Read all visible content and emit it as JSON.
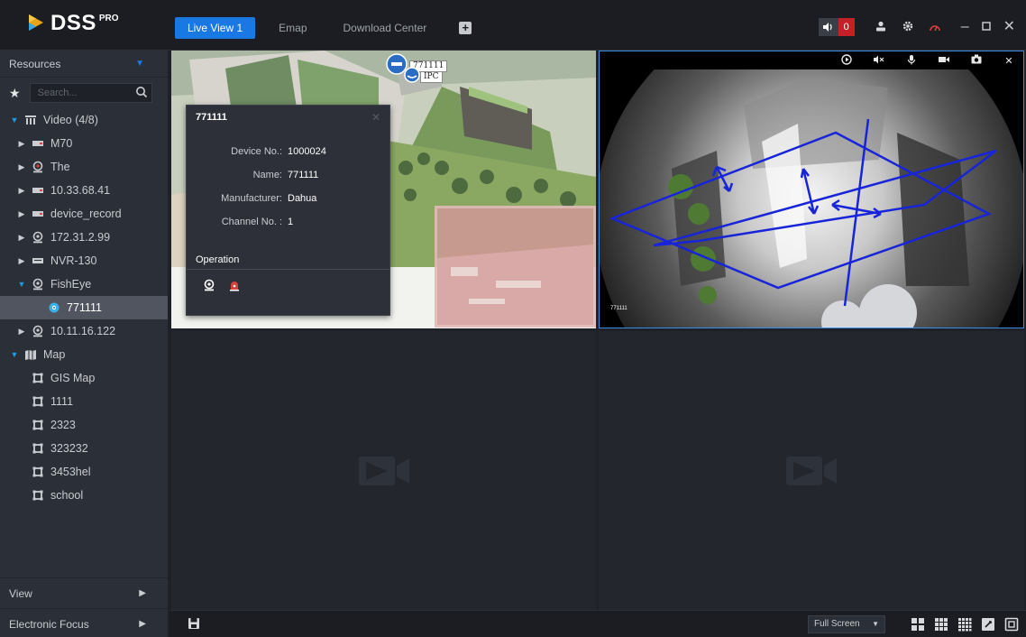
{
  "app": {
    "brand": "DSS",
    "brand_sup": "PRO"
  },
  "tabs": [
    {
      "label": "Live View 1",
      "active": true
    },
    {
      "label": "Emap",
      "active": false
    },
    {
      "label": "Download Center",
      "active": false
    }
  ],
  "topbar": {
    "alarm_count": "0",
    "accent_color": "#1a78e2",
    "alarm_color": "#c42126"
  },
  "sidebar": {
    "resources_label": "Resources",
    "search_placeholder": "Search...",
    "tree": [
      {
        "label": "Video (4/8)",
        "level": 0,
        "icon": "video-group-icon",
        "expanded": true
      },
      {
        "label": "M70",
        "level": 1,
        "icon": "dvr-icon"
      },
      {
        "label": "The",
        "level": 1,
        "icon": "camera-group-icon"
      },
      {
        "label": "10.33.68.41",
        "level": 1,
        "icon": "dvr-icon"
      },
      {
        "label": "device_record",
        "level": 1,
        "icon": "dvr-icon"
      },
      {
        "label": "172.31.2.99",
        "level": 1,
        "icon": "camera-group-icon"
      },
      {
        "label": "NVR-130",
        "level": 1,
        "icon": "nvr-icon"
      },
      {
        "label": "FishEye",
        "level": 1,
        "icon": "camera-group-icon",
        "expanded": true
      },
      {
        "label": "771111",
        "level": 2,
        "icon": "fisheye-camera-icon",
        "selected": true
      },
      {
        "label": "10.11.16.122",
        "level": 1,
        "icon": "camera-group-icon"
      },
      {
        "label": "Map",
        "level": 0,
        "icon": "map-icon",
        "expanded": true
      },
      {
        "label": "GIS Map",
        "level": 1,
        "icon": "map-frame-icon"
      },
      {
        "label": "1111",
        "level": 1,
        "icon": "map-frame-icon"
      },
      {
        "label": "2323",
        "level": 1,
        "icon": "map-frame-icon"
      },
      {
        "label": "323232",
        "level": 1,
        "icon": "map-frame-icon"
      },
      {
        "label": "3453hel",
        "level": 1,
        "icon": "map-frame-icon"
      },
      {
        "label": "school",
        "level": 1,
        "icon": "map-frame-icon"
      }
    ],
    "view_label": "View",
    "focus_label": "Electronic Focus"
  },
  "map_pane": {
    "pin_label_1": "771111",
    "pin_label_2": "IPC",
    "popup": {
      "title": "771111",
      "fields": [
        {
          "key": "Device No.:",
          "value": "1000024"
        },
        {
          "key": "Name:",
          "value": "771111"
        },
        {
          "key": "Manufacturer:",
          "value": "Dahua"
        },
        {
          "key": "Channel No. :",
          "value": "1"
        }
      ],
      "operation_label": "Operation"
    }
  },
  "fisheye_pane": {
    "osd_label": "771111"
  },
  "bottombar": {
    "fullscreen_label": "Full Screen"
  }
}
